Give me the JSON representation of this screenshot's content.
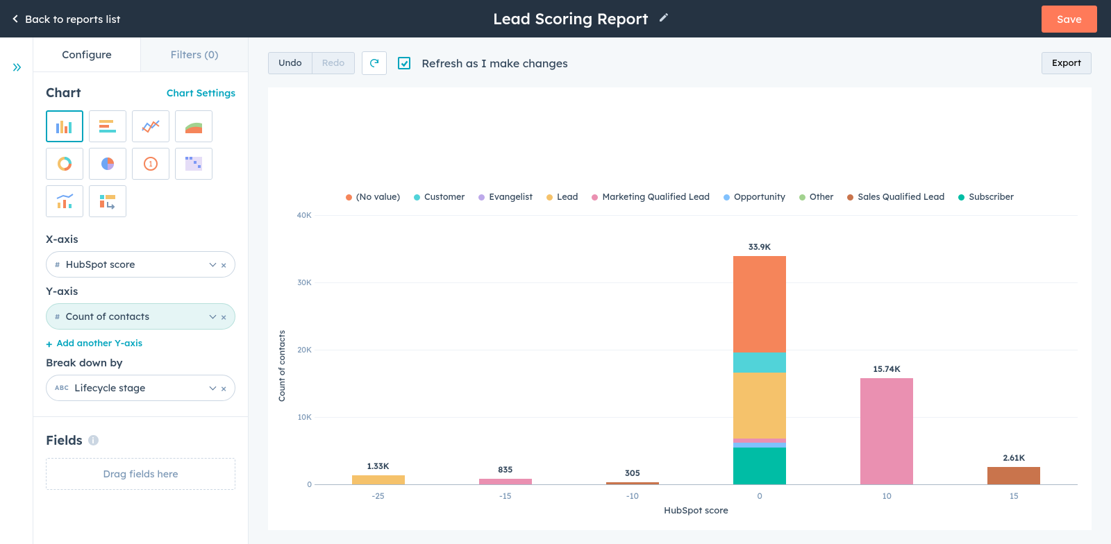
{
  "header": {
    "back_label": "Back to reports list",
    "title": "Lead Scoring Report",
    "save_label": "Save"
  },
  "sidebar": {
    "tabs": {
      "configure": "Configure",
      "filters": "Filters (0)"
    },
    "chart": {
      "heading": "Chart",
      "settings": "Chart Settings"
    },
    "xaxis": {
      "label": "X-axis",
      "field": "HubSpot score",
      "tag": "#"
    },
    "yaxis": {
      "label": "Y-axis",
      "field": "Count of contacts",
      "tag": "#",
      "add": "Add another Y-axis"
    },
    "breakdown": {
      "label": "Break down by",
      "field": "Lifecycle stage",
      "tag": "ABC"
    },
    "fields": {
      "heading": "Fields",
      "drop": "Drag fields here"
    }
  },
  "toolbar": {
    "undo": "Undo",
    "redo": "Redo",
    "refresh_label": "Refresh as I make changes",
    "export": "Export"
  },
  "chart_data": {
    "type": "bar",
    "title": "",
    "xlabel": "HubSpot score",
    "ylabel": "Count of contacts",
    "ylim": [
      0,
      40000
    ],
    "yticks": [
      "0",
      "10K",
      "20K",
      "30K",
      "40K"
    ],
    "categories": [
      "-25",
      "-15",
      "-10",
      "0",
      "10",
      "15"
    ],
    "totals_labels": [
      "1.33K",
      "835",
      "305",
      "33.9K",
      "15.74K",
      "2.61K"
    ],
    "series": [
      {
        "name": "(No value)",
        "color": "#f5855a",
        "values": [
          0,
          0,
          0,
          14300,
          0,
          0
        ]
      },
      {
        "name": "Customer",
        "color": "#51d3d9",
        "values": [
          0,
          0,
          0,
          3000,
          0,
          0
        ]
      },
      {
        "name": "Evangelist",
        "color": "#bda9ea",
        "values": [
          0,
          0,
          0,
          0,
          0,
          0
        ]
      },
      {
        "name": "Lead",
        "color": "#f5c26b",
        "values": [
          1330,
          0,
          0,
          9800,
          0,
          0
        ]
      },
      {
        "name": "Marketing Qualified Lead",
        "color": "#ea90b1",
        "values": [
          0,
          835,
          0,
          600,
          15740,
          0
        ]
      },
      {
        "name": "Opportunity",
        "color": "#81c1fd",
        "values": [
          0,
          0,
          0,
          700,
          0,
          0
        ]
      },
      {
        "name": "Other",
        "color": "#a2d28f",
        "values": [
          0,
          0,
          0,
          0,
          0,
          0
        ]
      },
      {
        "name": "Sales Qualified Lead",
        "color": "#c9744c",
        "values": [
          0,
          0,
          305,
          0,
          0,
          2610
        ]
      },
      {
        "name": "Subscriber",
        "color": "#00bda5",
        "values": [
          0,
          0,
          0,
          5500,
          0,
          0
        ]
      }
    ]
  }
}
